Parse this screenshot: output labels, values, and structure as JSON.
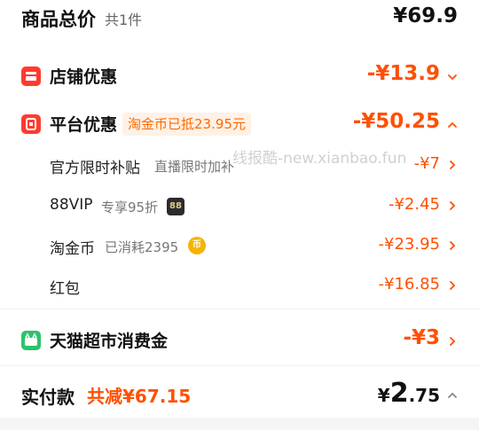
{
  "colors": {
    "accent": "#ff5000",
    "shop_icon": "#ff3b30",
    "tmall_icon": "#2cc36b",
    "tag_bg": "#fff1e6"
  },
  "total": {
    "title": "商品总价",
    "count": "共1件",
    "amount": "¥69.9"
  },
  "shop": {
    "title": "店铺优惠",
    "price": "-¥13.9",
    "icon": "shop-icon"
  },
  "platform": {
    "title": "平台优惠",
    "tag": "淘金币已抵23.95元",
    "price": "-¥50.25",
    "icon": "platform-icon"
  },
  "items": [
    {
      "label": "官方限时补贴",
      "note": "直播限时加补",
      "price": "-¥7"
    },
    {
      "label": "88VIP",
      "note": "专享95折",
      "mark": "88",
      "price": "-¥2.45"
    },
    {
      "label": "淘金币",
      "note": "已消耗2395",
      "mark": "币",
      "price": "-¥23.95"
    },
    {
      "label": "红包",
      "note": "",
      "price": "-¥16.85"
    }
  ],
  "tmall": {
    "title": "天猫超市消费金",
    "price": "-¥3",
    "icon": "tmall-icon"
  },
  "pay": {
    "title": "实付款",
    "save": "共减¥67.15",
    "currency": "¥",
    "int_part": "2",
    "dec_part": ".75"
  },
  "watermark": "线报酷-new.xianbao.fun"
}
